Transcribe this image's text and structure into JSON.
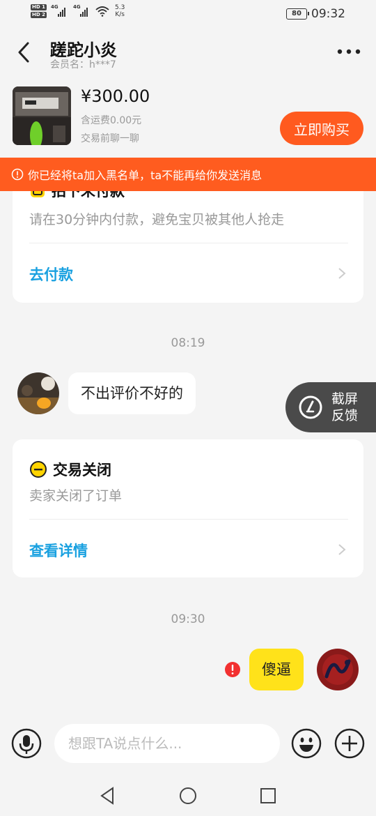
{
  "status_bar": {
    "hd1": "HD 1",
    "hd2": "HD 2",
    "net1": "4G",
    "net2": "4G",
    "speed_value": "5.3",
    "speed_unit": "K/s",
    "battery": "80",
    "time": "09:32"
  },
  "header": {
    "title": "蹉跎小炎",
    "subtitle": "会员名：h***7"
  },
  "product": {
    "price": "¥300.00",
    "shipping": "含运费0.00元",
    "note": "交易前聊一聊",
    "buy_label": "立即购买"
  },
  "banner": {
    "text": "你已经将ta加入黑名单，ta不能再给你发送消息"
  },
  "payment_card": {
    "title": "拍下未付款",
    "desc": "请在30分钟内付款，避免宝贝被其他人抢走",
    "action": "去付款"
  },
  "messages": {
    "time1": "08:19",
    "incoming_text": "不出评价不好的",
    "time2": "09:30",
    "outgoing_text": "傻逼"
  },
  "closed_card": {
    "title": "交易关闭",
    "desc": "卖家关闭了订单",
    "action": "查看详情"
  },
  "feedback": {
    "label": "截屏反馈"
  },
  "input": {
    "placeholder": "想跟TA说点什么..."
  },
  "colors": {
    "accent_orange": "#ff5a1f",
    "link_blue": "#1aa1e0",
    "bubble_yellow": "#ffe21a"
  }
}
